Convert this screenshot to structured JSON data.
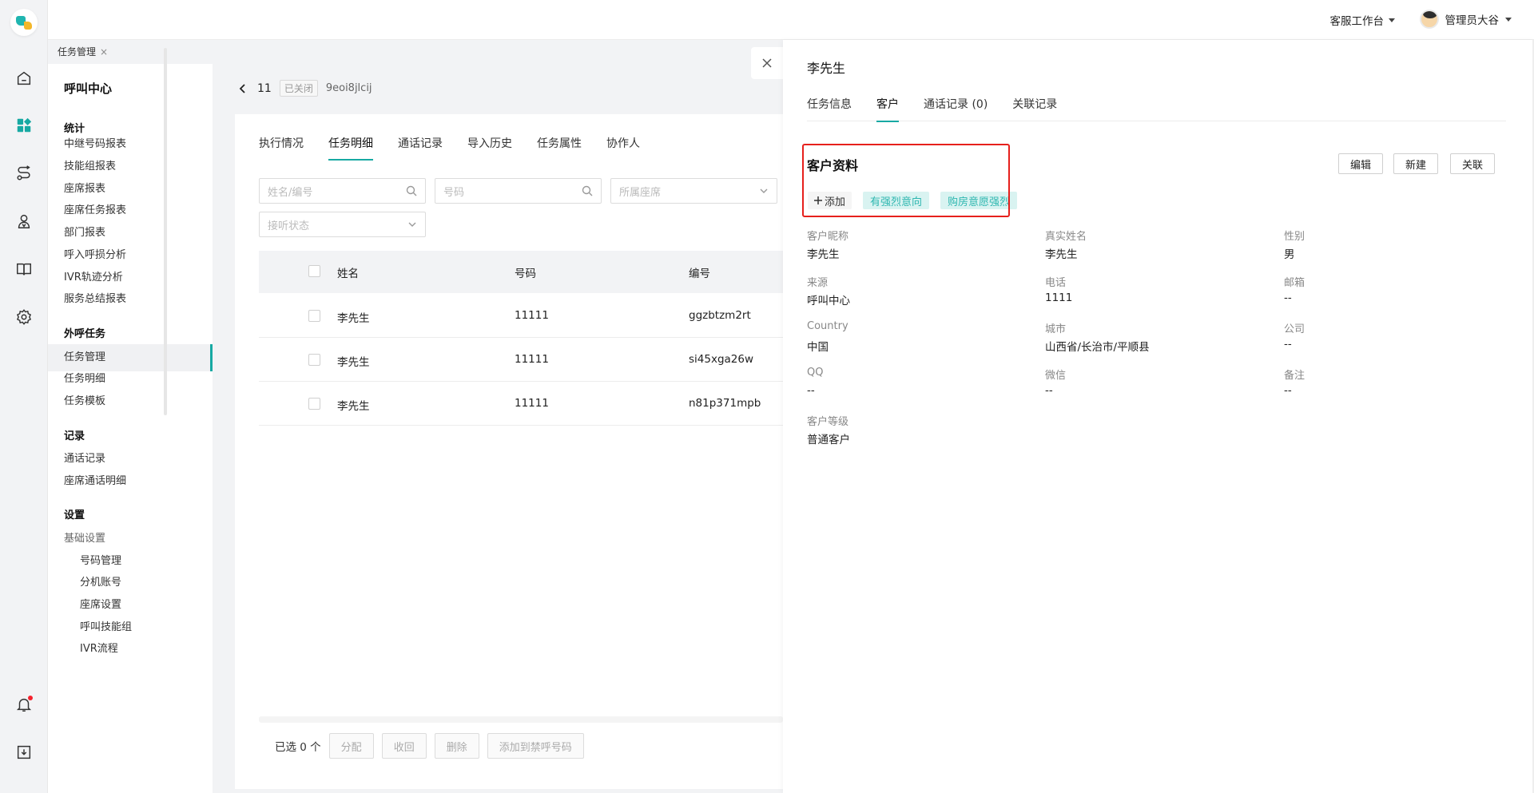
{
  "rail": {
    "icons": [
      "home-icon",
      "dashboard-icon",
      "route-icon",
      "agent-icon",
      "book-icon",
      "settings-icon",
      "bell-icon",
      "download-icon"
    ]
  },
  "header": {
    "workbench": "客服工作台",
    "user_name": "管理员大谷"
  },
  "tabstrip": {
    "open_tab": "任务管理",
    "close": "×"
  },
  "sidenav": {
    "title": "呼叫中心",
    "groups": [
      {
        "label": "统计",
        "items": [
          "中继号码报表",
          "技能组报表",
          "座席报表",
          "座席任务报表",
          "部门报表",
          "呼入呼损分析",
          "IVR轨迹分析",
          "服务总结报表"
        ]
      },
      {
        "label": "外呼任务",
        "items": [
          "任务管理",
          "任务明细",
          "任务模板"
        ]
      },
      {
        "label": "记录",
        "items": [
          "通话记录",
          "座席通话明细"
        ]
      },
      {
        "label": "设置",
        "items": [
          "基础设置",
          "号码管理",
          "分机账号",
          "座席设置",
          "呼叫技能组",
          "IVR流程"
        ]
      }
    ]
  },
  "task": {
    "id": "11",
    "status": "已关闭",
    "code": "9eoi8jlcij",
    "tabs": [
      "执行情况",
      "任务明细",
      "通话记录",
      "导入历史",
      "任务属性",
      "协作人"
    ],
    "filters": {
      "name_placeholder": "姓名/编号",
      "number_placeholder": "号码",
      "seat_placeholder": "所属座席",
      "answer_placeholder": "接听状态"
    },
    "table": {
      "headers": [
        "姓名",
        "号码",
        "编号"
      ],
      "rows": [
        {
          "name": "李先生",
          "number": "11111",
          "code": "ggzbtzm2rt"
        },
        {
          "name": "李先生",
          "number": "11111",
          "code": "si45xga26w"
        },
        {
          "name": "李先生",
          "number": "11111",
          "code": "n81p371mpb"
        }
      ]
    },
    "footer": {
      "selected": "已选 0 个",
      "buttons": [
        "分配",
        "收回",
        "删除",
        "添加到禁呼号码"
      ]
    }
  },
  "drawer": {
    "title": "李先生",
    "tabs": [
      "任务信息",
      "客户",
      "通话记录 (0)",
      "关联记录"
    ],
    "section_title": "客户资料",
    "add_label": "添加",
    "tags": [
      "有强烈意向",
      "购房意愿强烈"
    ],
    "actions": [
      "编辑",
      "新建",
      "关联"
    ],
    "fields": [
      {
        "label": "客户昵称",
        "value": "李先生"
      },
      {
        "label": "真实姓名",
        "value": "李先生"
      },
      {
        "label": "性别",
        "value": "男"
      },
      {
        "label": "来源",
        "value": "呼叫中心"
      },
      {
        "label": "电话",
        "value": "1111"
      },
      {
        "label": "邮箱",
        "value": "--"
      },
      {
        "label": "Country",
        "value": "中国"
      },
      {
        "label": "城市",
        "value": "山西省/长治市/平顺县"
      },
      {
        "label": "公司",
        "value": "--"
      },
      {
        "label": "QQ",
        "value": "--"
      },
      {
        "label": "微信",
        "value": "--"
      },
      {
        "label": "备注",
        "value": "--"
      },
      {
        "label": "客户等级",
        "value": "普通客户"
      }
    ]
  },
  "colors": {
    "accent": "#17a9a3",
    "highlight": "#e6201c",
    "tag_bg": "#d9f3f1",
    "tag_text": "#2fb7b0"
  }
}
